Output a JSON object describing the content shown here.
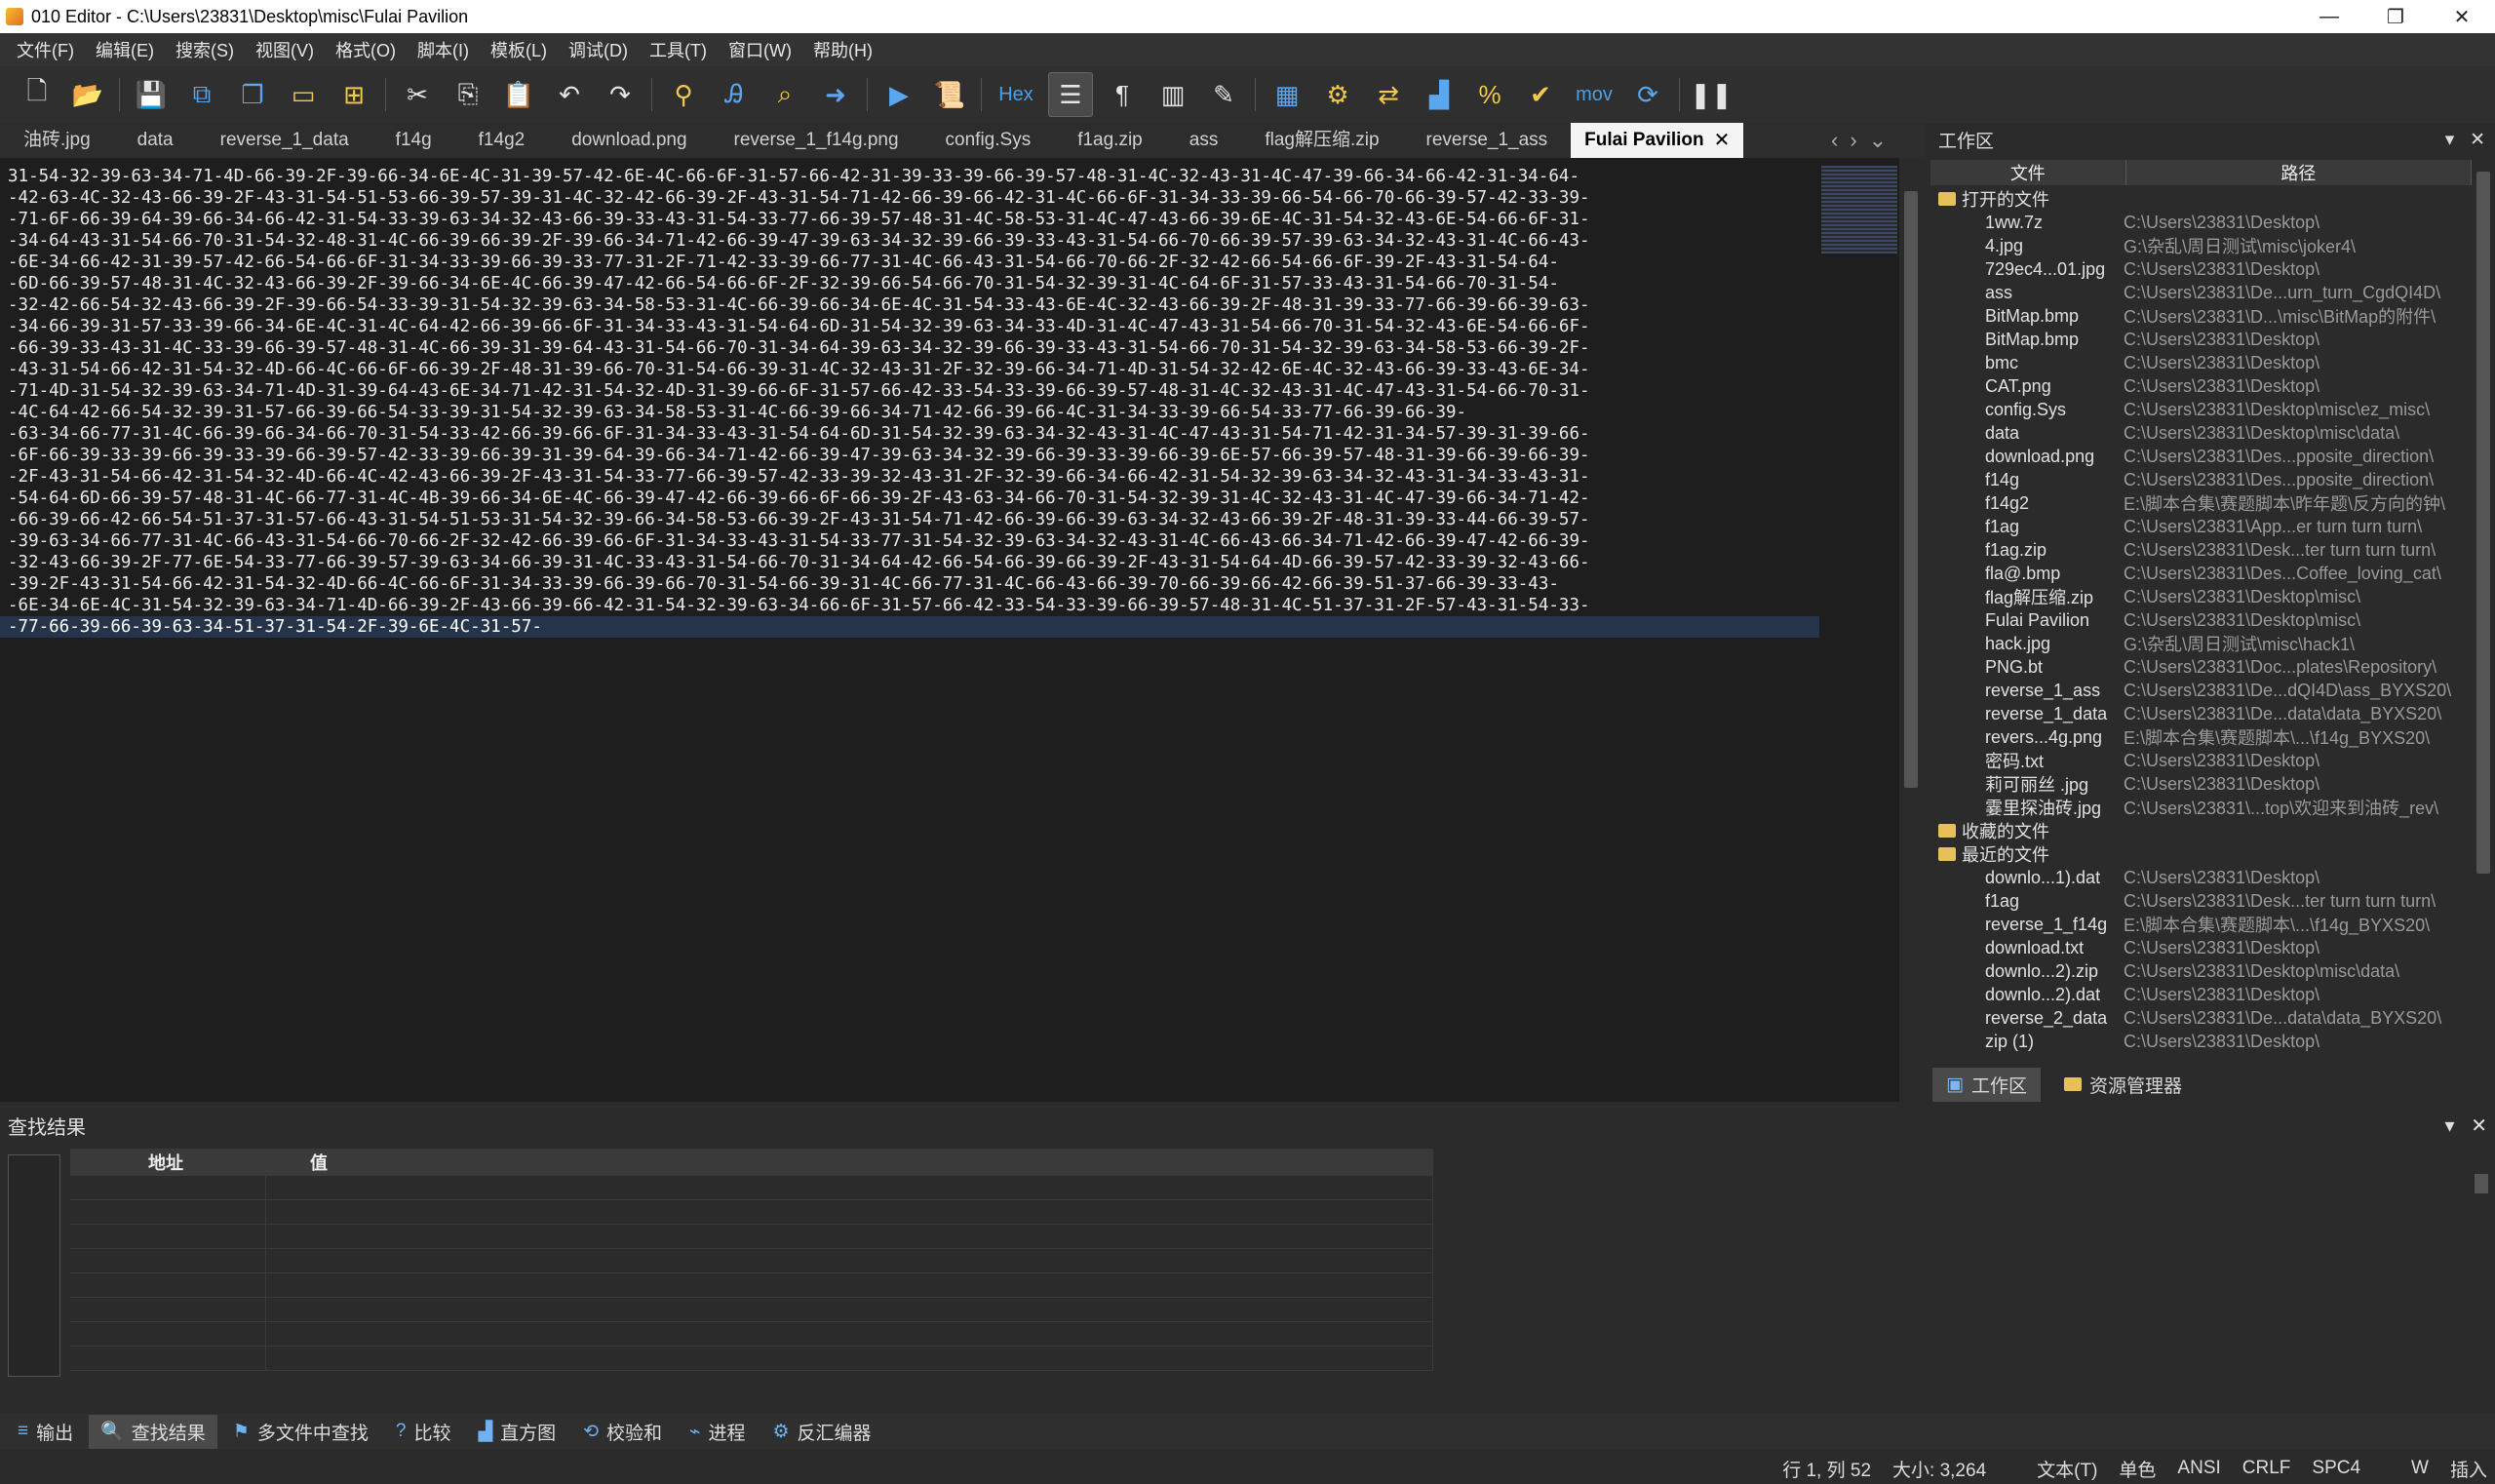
{
  "window": {
    "title": "010 Editor - C:\\Users\\23831\\Desktop\\misc\\Fulai Pavilion",
    "minimize": "—",
    "maximize": "❐",
    "close": "✕"
  },
  "menu": [
    "文件(F)",
    "编辑(E)",
    "搜索(S)",
    "视图(V)",
    "格式(O)",
    "脚本(I)",
    "模板(L)",
    "调试(D)",
    "工具(T)",
    "窗口(W)",
    "帮助(H)"
  ],
  "toolbar": {
    "hex_label": "Hex",
    "mov_label": "mov",
    "icons": [
      "new-file-icon",
      "open-icon",
      "save-icon",
      "save-as-icon",
      "save-all-icon",
      "folder-icon",
      "open-folder-icon",
      "cut-icon",
      "copy-icon",
      "paste-icon",
      "undo-icon",
      "redo-icon",
      "find-icon",
      "replace-icon",
      "find-in-files-icon",
      "goto-icon",
      "template-icon",
      "script-icon",
      "hex-mode-icon",
      "text-mode-icon",
      "paragraph-icon",
      "columns-icon",
      "highlight-icon",
      "calculator-icon",
      "inspector-icon",
      "compare-icon",
      "histogram-icon",
      "percent-icon",
      "checksum-icon",
      "base-convert-icon",
      "pause-icon"
    ]
  },
  "tabs": [
    "油砖.jpg",
    "data",
    "reverse_1_data",
    "f14g",
    "f14g2",
    "download.png",
    "reverse_1_f14g.png",
    "config.Sys",
    "f1ag.zip",
    "ass",
    "flag解压缩.zip",
    "reverse_1_ass"
  ],
  "active_tab": "Fulai Pavilion",
  "editor_lines": [
    "31-54-32-39-63-34-71-4D-66-39-2F-39-66-34-6E-4C-31-39-57-42-6E-4C-66-6F-31-57-66-42-31-39-33-39-66-39-57-48-31-4C-32-43-31-4C-47-39-66-34-66-42-31-34-64-",
    "-42-63-4C-32-43-66-39-2F-43-31-54-51-53-66-39-57-39-31-4C-32-42-66-39-2F-43-31-54-71-42-66-39-66-42-31-4C-66-6F-31-34-33-39-66-54-66-70-66-39-57-42-33-39-",
    "-71-6F-66-39-64-39-66-34-66-42-31-54-33-39-63-34-32-43-66-39-33-43-31-54-33-77-66-39-57-48-31-4C-58-53-31-4C-47-43-66-39-6E-4C-31-54-32-43-6E-54-66-6F-31-",
    "-34-64-43-31-54-66-70-31-54-32-48-31-4C-66-39-66-39-2F-39-66-34-71-42-66-39-47-39-63-34-32-39-66-39-33-43-31-54-66-70-66-39-57-39-63-34-32-43-31-4C-66-43-",
    "-6E-34-66-42-31-39-57-42-66-54-66-6F-31-34-33-39-66-39-33-77-31-2F-71-42-33-39-66-77-31-4C-66-43-31-54-66-70-66-2F-32-42-66-54-66-6F-39-2F-43-31-54-64-",
    "-6D-66-39-57-48-31-4C-32-43-66-39-2F-39-66-34-6E-4C-66-39-47-42-66-54-66-6F-2F-32-39-66-54-66-70-31-54-32-39-31-4C-64-6F-31-57-33-43-31-54-66-70-31-54-",
    "-32-42-66-54-32-43-66-39-2F-39-66-54-33-39-31-54-32-39-63-34-58-53-31-4C-66-39-66-34-6E-4C-31-54-33-43-6E-4C-32-43-66-39-2F-48-31-39-33-77-66-39-66-39-63-",
    "-34-66-39-31-57-33-39-66-34-6E-4C-31-4C-64-42-66-39-66-6F-31-34-33-43-31-54-64-6D-31-54-32-39-63-34-33-4D-31-4C-47-43-31-54-66-70-31-54-32-43-6E-54-66-6F-",
    "-66-39-33-43-31-4C-33-39-66-39-57-48-31-4C-66-39-31-39-64-43-31-54-66-70-31-34-64-39-63-34-32-39-66-39-33-43-31-54-66-70-31-54-32-39-63-34-58-53-66-39-2F-",
    "-43-31-54-66-42-31-54-32-4D-66-4C-66-6F-66-39-2F-48-31-39-66-70-31-54-66-39-31-4C-32-43-31-2F-32-39-66-34-71-4D-31-54-32-42-6E-4C-32-43-66-39-33-43-6E-34-",
    "-71-4D-31-54-32-39-63-34-71-4D-31-39-64-43-6E-34-71-42-31-54-32-4D-31-39-66-6F-31-57-66-42-33-54-33-39-66-39-57-48-31-4C-32-43-31-4C-47-43-31-54-66-70-31-",
    "-4C-64-42-66-54-32-39-31-57-66-39-66-54-33-39-31-54-32-39-63-34-58-53-31-4C-66-39-66-34-71-42-66-39-66-4C-31-34-33-39-66-54-33-77-66-39-66-39-",
    "-63-34-66-77-31-4C-66-39-66-34-66-70-31-54-33-42-66-39-66-6F-31-34-33-43-31-54-64-6D-31-54-32-39-63-34-32-43-31-4C-47-43-31-54-71-42-31-34-57-39-31-39-66-",
    "-6F-66-39-33-39-66-39-33-39-66-39-57-42-33-39-66-39-31-39-64-39-66-34-71-42-66-39-47-39-63-34-32-39-66-39-33-39-66-39-6E-57-66-39-57-48-31-39-66-39-66-39-",
    "-2F-43-31-54-66-42-31-54-32-4D-66-4C-42-43-66-39-2F-43-31-54-33-77-66-39-57-42-33-39-32-43-31-2F-32-39-66-34-66-42-31-54-32-39-63-34-32-43-31-34-33-43-31-",
    "-54-64-6D-66-39-57-48-31-4C-66-77-31-4C-4B-39-66-34-6E-4C-66-39-47-42-66-39-66-6F-66-39-2F-43-63-34-66-70-31-54-32-39-31-4C-32-43-31-4C-47-39-66-34-71-42-",
    "-66-39-66-42-66-54-51-37-31-57-66-43-31-54-51-53-31-54-32-39-66-34-58-53-66-39-2F-43-31-54-71-42-66-39-66-39-63-34-32-43-66-39-2F-48-31-39-33-44-66-39-57-",
    "-39-63-34-66-77-31-4C-66-43-31-54-66-70-66-2F-32-42-66-39-66-6F-31-34-33-43-31-54-33-77-31-54-32-39-63-34-32-43-31-4C-66-43-66-34-71-42-66-39-47-42-66-39-",
    "-32-43-66-39-2F-77-6E-54-33-77-66-39-57-39-63-34-66-39-31-4C-33-43-31-54-66-70-31-34-64-42-66-54-66-39-66-39-2F-43-31-54-64-4D-66-39-57-42-33-39-32-43-66-",
    "-39-2F-43-31-54-66-42-31-54-32-4D-66-4C-66-6F-31-34-33-39-66-39-66-70-31-54-66-39-31-4C-66-77-31-4C-66-43-66-39-70-66-39-66-42-66-39-51-37-66-39-33-43-",
    "-6E-34-6E-4C-31-54-32-39-63-34-71-4D-66-39-2F-43-66-39-66-42-31-54-32-39-63-34-66-6F-31-57-66-42-33-54-33-39-66-39-57-48-31-4C-51-37-31-2F-57-43-31-54-33-",
    "-77-66-39-66-39-63-34-51-37-31-54-2F-39-6E-4C-31-57-"
  ],
  "workspace": {
    "title": "工作区",
    "col_file": "文件",
    "col_path": "路径",
    "open_group": "打开的文件",
    "open_files": [
      {
        "name": "1ww.7z",
        "path": "C:\\Users\\23831\\Desktop\\"
      },
      {
        "name": "4.jpg",
        "path": "G:\\杂乱\\周日测试\\misc\\joker4\\"
      },
      {
        "name": "729ec4...01.jpg",
        "path": "C:\\Users\\23831\\Desktop\\"
      },
      {
        "name": "ass",
        "path": "C:\\Users\\23831\\De...urn_turn_CgdQI4D\\"
      },
      {
        "name": "BitMap.bmp",
        "path": "C:\\Users\\23831\\D...\\misc\\BitMap的附件\\"
      },
      {
        "name": "BitMap.bmp",
        "path": "C:\\Users\\23831\\Desktop\\"
      },
      {
        "name": "bmc",
        "path": "C:\\Users\\23831\\Desktop\\"
      },
      {
        "name": "CAT.png",
        "path": "C:\\Users\\23831\\Desktop\\"
      },
      {
        "name": "config.Sys",
        "path": "C:\\Users\\23831\\Desktop\\misc\\ez_misc\\"
      },
      {
        "name": "data",
        "path": "C:\\Users\\23831\\Desktop\\misc\\data\\"
      },
      {
        "name": "download.png",
        "path": "C:\\Users\\23831\\Des...pposite_direction\\"
      },
      {
        "name": "f14g",
        "path": "C:\\Users\\23831\\Des...pposite_direction\\"
      },
      {
        "name": "f14g2",
        "path": "E:\\脚本合集\\赛题脚本\\昨年题\\反方向的钟\\"
      },
      {
        "name": "f1ag",
        "path": "C:\\Users\\23831\\App...er turn turn turn\\"
      },
      {
        "name": "f1ag.zip",
        "path": "C:\\Users\\23831\\Desk...ter turn turn turn\\"
      },
      {
        "name": "fla@.bmp",
        "path": "C:\\Users\\23831\\Des...Coffee_loving_cat\\"
      },
      {
        "name": "flag解压缩.zip",
        "path": "C:\\Users\\23831\\Desktop\\misc\\"
      },
      {
        "name": "Fulai Pavilion",
        "path": "C:\\Users\\23831\\Desktop\\misc\\"
      },
      {
        "name": "hack.jpg",
        "path": "G:\\杂乱\\周日测试\\misc\\hack1\\"
      },
      {
        "name": "PNG.bt",
        "path": "C:\\Users\\23831\\Doc...plates\\Repository\\"
      },
      {
        "name": "reverse_1_ass",
        "path": "C:\\Users\\23831\\De...dQI4D\\ass_BYXS20\\"
      },
      {
        "name": "reverse_1_data",
        "path": "C:\\Users\\23831\\De...data\\data_BYXS20\\"
      },
      {
        "name": "revers...4g.png",
        "path": "E:\\脚本合集\\赛题脚本\\...\\f14g_BYXS20\\"
      },
      {
        "name": "密码.txt",
        "path": "C:\\Users\\23831\\Desktop\\"
      },
      {
        "name": "莉可丽丝 .jpg",
        "path": "C:\\Users\\23831\\Desktop\\"
      },
      {
        "name": "霎里探油砖.jpg",
        "path": "C:\\Users\\23831\\...top\\欢迎来到油砖_rev\\"
      }
    ],
    "fav_group": "收藏的文件",
    "recent_group": "最近的文件",
    "recent_files": [
      {
        "name": "downlo...1).dat",
        "path": "C:\\Users\\23831\\Desktop\\"
      },
      {
        "name": "f1ag",
        "path": "C:\\Users\\23831\\Desk...ter turn turn turn\\"
      },
      {
        "name": "reverse_1_f14g",
        "path": "E:\\脚本合集\\赛题脚本\\...\\f14g_BYXS20\\"
      },
      {
        "name": "download.txt",
        "path": "C:\\Users\\23831\\Desktop\\"
      },
      {
        "name": "downlo...2).zip",
        "path": "C:\\Users\\23831\\Desktop\\misc\\data\\"
      },
      {
        "name": "downlo...2).dat",
        "path": "C:\\Users\\23831\\Desktop\\"
      },
      {
        "name": "reverse_2_data",
        "path": "C:\\Users\\23831\\De...data\\data_BYXS20\\"
      },
      {
        "name": "zip (1)",
        "path": "C:\\Users\\23831\\Desktop\\"
      }
    ],
    "tab_workspace": "工作区",
    "tab_explorer": "资源管理器"
  },
  "find": {
    "title": "查找结果",
    "col_address": "地址",
    "col_value": "值"
  },
  "bottom_tabs": [
    "输出",
    "查找结果",
    "多文件中查找",
    "比较",
    "直方图",
    "校验和",
    "进程",
    "反汇编器"
  ],
  "status": {
    "position": "行 1, 列 52",
    "size": "大小: 3,264",
    "mode": "文本(T)",
    "byte": "单色",
    "encoding": "ANSI",
    "line_end": "CRLF",
    "tab": "SPC4",
    "write": "W",
    "insert": "插入"
  }
}
